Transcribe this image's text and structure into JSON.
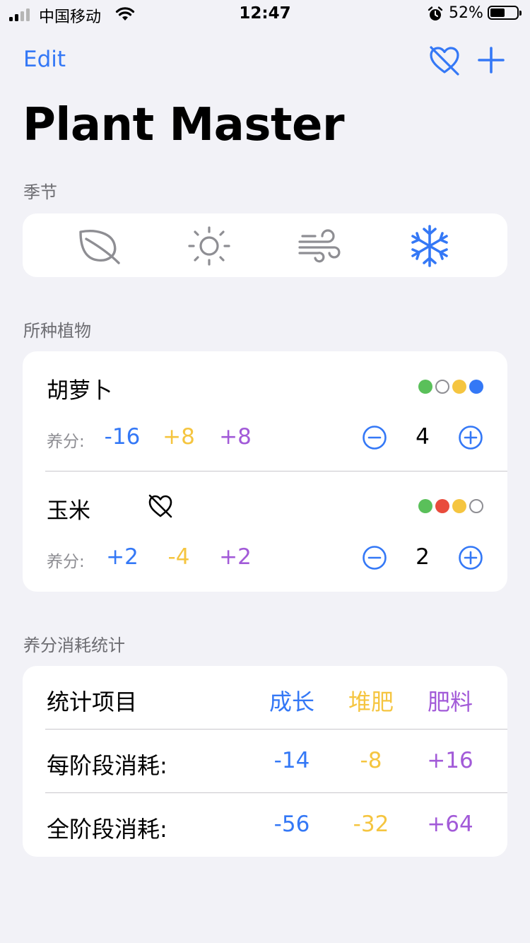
{
  "status_bar": {
    "carrier": "中国移动",
    "time": "12:47",
    "battery_percent": "52%",
    "battery_level": 0.52
  },
  "nav": {
    "edit_label": "Edit",
    "title": "Plant Master",
    "heart_icon": "heart-slash-icon",
    "add_icon": "plus-icon"
  },
  "seasons": {
    "label": "季节",
    "items": [
      {
        "name": "spring",
        "icon": "leaf-icon",
        "selected": false
      },
      {
        "name": "summer",
        "icon": "sun-icon",
        "selected": false
      },
      {
        "name": "autumn",
        "icon": "wind-icon",
        "selected": false
      },
      {
        "name": "winter",
        "icon": "snowflake-icon",
        "selected": true
      }
    ]
  },
  "plants": {
    "label": "所种植物",
    "nutrient_label": "养分:",
    "items": [
      {
        "name": "胡萝卜",
        "favorite_disabled": false,
        "seasons": [
          "#5ac05a",
          "empty",
          "#f5c540",
          "#3478f6"
        ],
        "nutrients": [
          "-16",
          "+8",
          "+8"
        ],
        "count": "4"
      },
      {
        "name": "玉米",
        "favorite_disabled": true,
        "seasons": [
          "#5ac05a",
          "#e94b3c",
          "#f5c540",
          "empty"
        ],
        "nutrients": [
          "+2",
          "-4",
          "+2"
        ],
        "count": "2"
      }
    ]
  },
  "stats": {
    "label": "养分消耗统计",
    "header": {
      "item": "统计项目",
      "growth": "成长",
      "compost": "堆肥",
      "fertilizer": "肥料"
    },
    "rows": [
      {
        "label": "每阶段消耗:",
        "growth": "-14",
        "compost": "-8",
        "fertilizer": "+16"
      },
      {
        "label": "全阶段消耗:",
        "growth": "-56",
        "compost": "-32",
        "fertilizer": "+64"
      }
    ]
  },
  "colors": {
    "accent": "#3478f6",
    "growth": "#3478f6",
    "compost": "#f5c540",
    "fertilizer": "#a25ad8",
    "background": "#f2f2f7"
  }
}
